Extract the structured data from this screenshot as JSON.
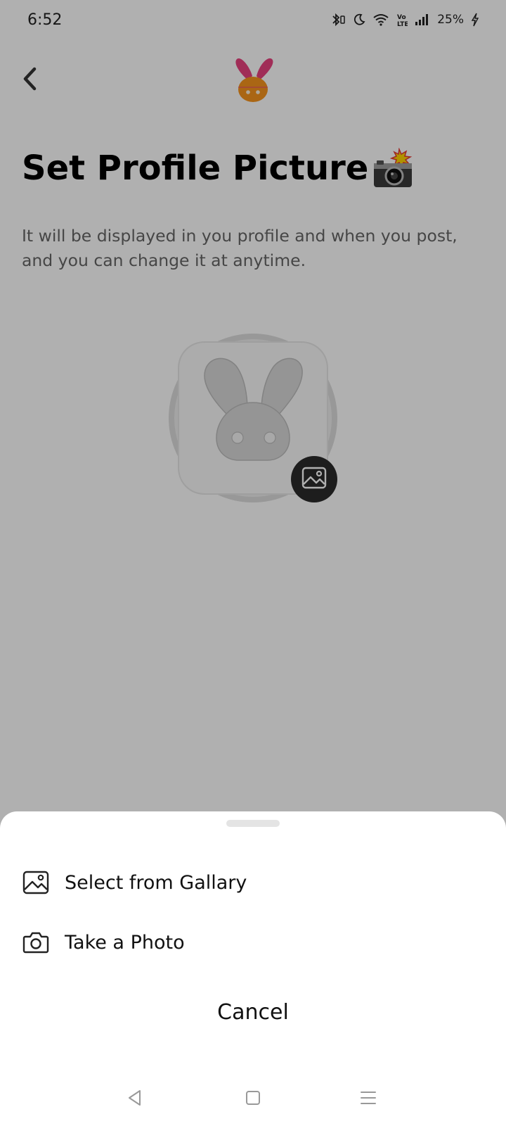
{
  "status_bar": {
    "time": "6:52",
    "battery": "25%",
    "icons": [
      "bluetooth-icon",
      "moon-icon",
      "wifi-icon",
      "volte-icon",
      "signal-icon",
      "charging-icon"
    ]
  },
  "header": {
    "back_icon": "chevron-left-icon",
    "logo_icon": "bunny-logo-icon"
  },
  "main": {
    "title": "Set Profile Picture",
    "title_emoji": "camera-flash-icon",
    "subtitle": "It will be displayed in you profile and when you post, and you can change it at anytime.",
    "avatar_icon": "bunny-avatar-icon",
    "edit_icon": "image-icon"
  },
  "sheet": {
    "options": [
      {
        "label": "Select from Gallary",
        "icon": "image-icon"
      },
      {
        "label": "Take a Photo",
        "icon": "camera-icon"
      }
    ],
    "cancel_label": "Cancel"
  },
  "nav_bar": {
    "icons": [
      "back-triangle-icon",
      "home-square-icon",
      "menu-lines-icon"
    ]
  },
  "colors": {
    "overlay": "rgba(0,0,0,0.31)",
    "logo_ears": "#e8427e",
    "logo_head": "#f7941d",
    "edit_button": "#2b2b2b",
    "avatar_gray": "#d8d8d8"
  }
}
